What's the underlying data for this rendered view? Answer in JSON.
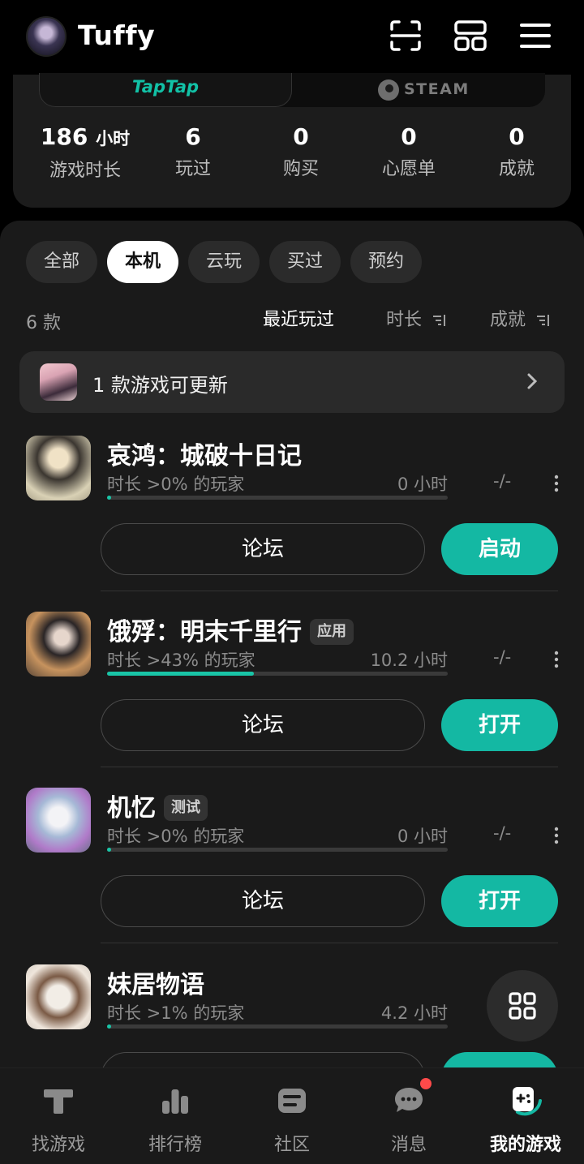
{
  "header": {
    "username": "Tuffy",
    "icons": [
      "scan-icon",
      "grid-icon",
      "menu-icon"
    ]
  },
  "platforms": {
    "taptap": "TapTap",
    "steam": "STEAM"
  },
  "stats": [
    {
      "value": "186",
      "unit": "小时",
      "label": "游戏时长"
    },
    {
      "value": "6",
      "unit": "",
      "label": "玩过"
    },
    {
      "value": "0",
      "unit": "",
      "label": "购买"
    },
    {
      "value": "0",
      "unit": "",
      "label": "心愿单"
    },
    {
      "value": "0",
      "unit": "",
      "label": "成就"
    }
  ],
  "filters": [
    "全部",
    "本机",
    "云玩",
    "买过",
    "预约"
  ],
  "active_filter": "本机",
  "list": {
    "count": "6 款",
    "sort": [
      "最近玩过",
      "时长",
      "成就"
    ]
  },
  "update_bar": {
    "text": "1 款游戏可更新"
  },
  "games": [
    {
      "name": "哀鸿：城破十日记",
      "badge": "",
      "pct": "时长 >0% 的玩家",
      "hours": "0 小时",
      "achievements": "-/-",
      "progress": 0.005,
      "forum": "论坛",
      "action": "启动"
    },
    {
      "name": "饿殍：明末千里行",
      "badge": "应用",
      "pct": "时长 >43% 的玩家",
      "hours": "10.2 小时",
      "achievements": "-/-",
      "progress": 0.43,
      "forum": "论坛",
      "action": "打开"
    },
    {
      "name": "机忆",
      "badge": "测试",
      "pct": "时长 >0% 的玩家",
      "hours": "0 小时",
      "achievements": "-/-",
      "progress": 0.005,
      "forum": "论坛",
      "action": "打开"
    },
    {
      "name": "妹居物语",
      "badge": "",
      "pct": "时长 >1% 的玩家",
      "hours": "4.2 小时",
      "achievements": "",
      "progress": 0.01,
      "forum": "",
      "action": ""
    }
  ],
  "bottom_nav": [
    {
      "label": "找游戏",
      "icon": "taptap-icon"
    },
    {
      "label": "排行榜",
      "icon": "ranking-icon"
    },
    {
      "label": "社区",
      "icon": "community-icon"
    },
    {
      "label": "消息",
      "icon": "message-icon"
    },
    {
      "label": "我的游戏",
      "icon": "my-games-icon"
    }
  ],
  "colors": {
    "accent": "#14b8a3",
    "notification": "#ff4a4a"
  }
}
